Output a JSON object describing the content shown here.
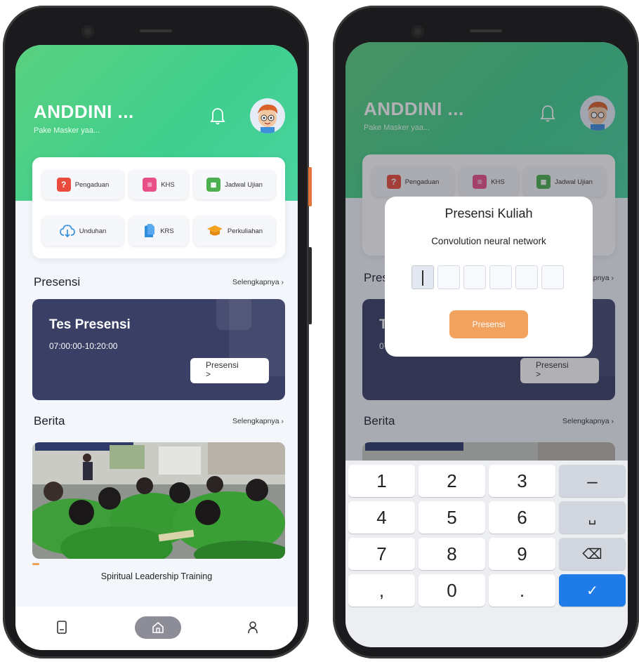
{
  "home": {
    "user_name": "ANDDINI ...",
    "user_subtitle": "Pake Masker yaa...",
    "menu": [
      {
        "label": "Pengaduan",
        "icon": "complaint-icon",
        "color": "#e94b3c"
      },
      {
        "label": "KHS",
        "icon": "document-list-icon",
        "color": "#e9508a"
      },
      {
        "label": "Jadwal Ujian",
        "icon": "calendar-icon",
        "color": "#4caf50"
      },
      {
        "label": "Unduhan",
        "icon": "cloud-download-icon",
        "color": "#2f8ee0"
      },
      {
        "label": "KRS",
        "icon": "files-icon",
        "color": "#2f8ee0"
      },
      {
        "label": "Perkuliahan",
        "icon": "graduation-cap-icon",
        "color": "#f2a21b"
      }
    ],
    "presensi_section": {
      "title": "Presensi",
      "more": "Selengkapnya"
    },
    "presensi_card": {
      "title": "Tes Presensi",
      "time": "07:00:00-10:20:00",
      "button": "Presensi",
      "button_arrow": ">"
    },
    "berita_section": {
      "title": "Berita",
      "more": "Selengkapnya"
    },
    "news": {
      "caption": "Spiritual Leadership Training"
    }
  },
  "dialog": {
    "title": "Presensi Kuliah",
    "course": "Convolution neural network",
    "code_digits": [
      "",
      "",
      "",
      "",
      "",
      ""
    ],
    "button": "Presensi"
  },
  "keyboard": {
    "keys": [
      "1",
      "2",
      "3",
      "–",
      "4",
      "5",
      "6",
      "␣",
      "7",
      "8",
      "9",
      "⌫",
      ",",
      "0",
      ".",
      "✓"
    ]
  },
  "colors": {
    "header_green": "#3fcf8f",
    "card_navy": "#3a3f66",
    "accent_orange": "#f2a25f",
    "keyboard_blue": "#1e7be8"
  }
}
